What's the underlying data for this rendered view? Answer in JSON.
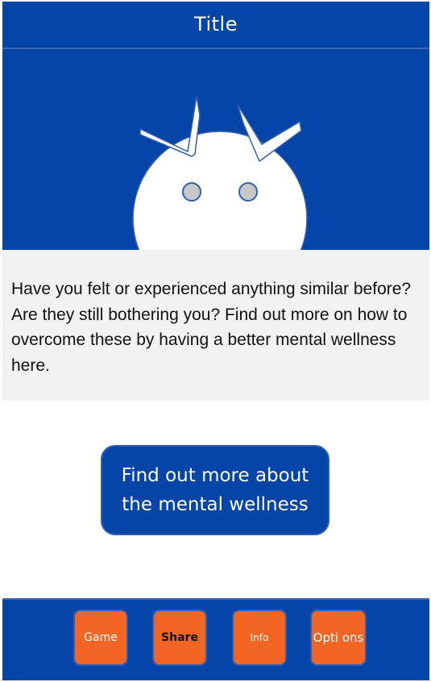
{
  "header": {
    "title": "Title"
  },
  "hero": {
    "illustration": "mascot-face-icon"
  },
  "card": {
    "text": "Have you felt or experienced anything similar before? Are they still bothering you? Find out more on how to overcome these by having a better mental wellness here."
  },
  "cta": {
    "label": "Find out more about the mental wellness"
  },
  "tabs": [
    {
      "label": "Game"
    },
    {
      "label": "Share"
    },
    {
      "label": "Info"
    },
    {
      "label": "Opti ons"
    }
  ],
  "colors": {
    "primary": "#0545A8",
    "accent": "#F26522",
    "card": "#F2F2F2"
  }
}
